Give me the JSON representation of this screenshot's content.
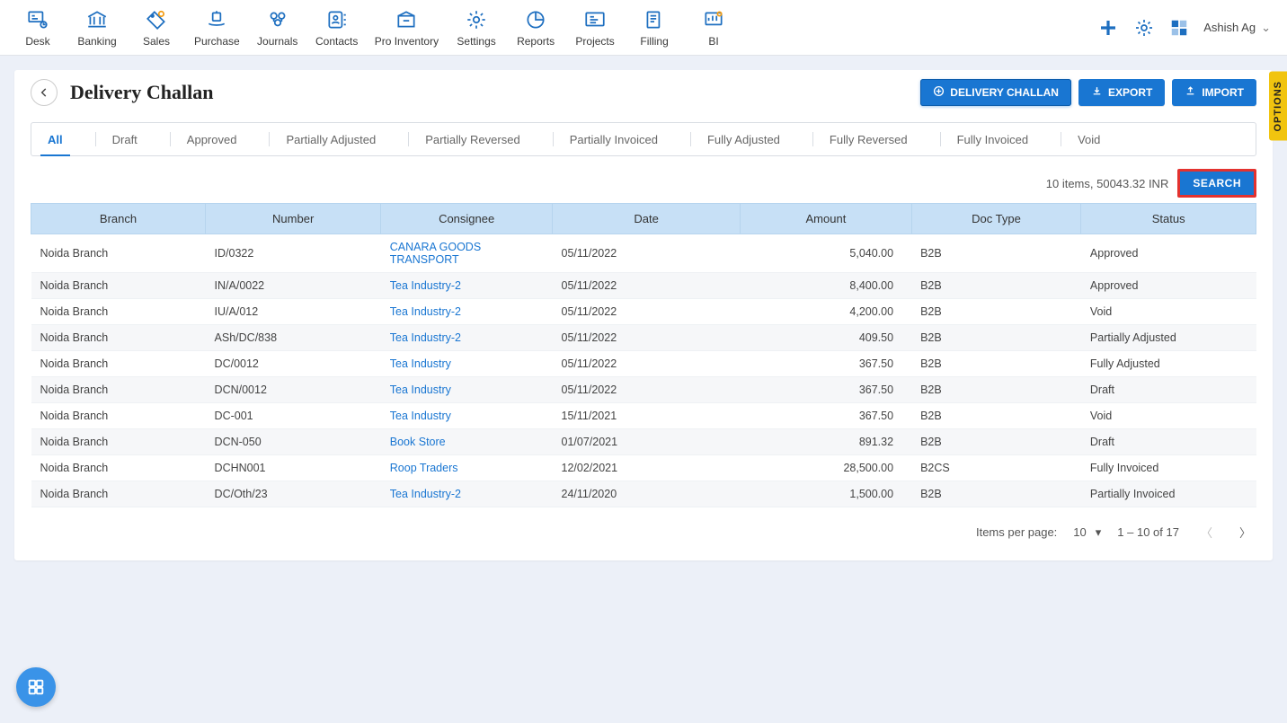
{
  "topnav": {
    "items": [
      {
        "label": "Desk"
      },
      {
        "label": "Banking"
      },
      {
        "label": "Sales"
      },
      {
        "label": "Purchase"
      },
      {
        "label": "Journals"
      },
      {
        "label": "Contacts"
      },
      {
        "label": "Pro Inventory"
      },
      {
        "label": "Settings"
      },
      {
        "label": "Reports"
      },
      {
        "label": "Projects"
      },
      {
        "label": "Filling"
      },
      {
        "label": "BI"
      }
    ],
    "user": "Ashish Ag"
  },
  "page": {
    "title": "Delivery Challan",
    "actions": {
      "create": "DELIVERY CHALLAN",
      "export": "EXPORT",
      "import": "IMPORT"
    }
  },
  "tabs": [
    {
      "label": "All",
      "active": true
    },
    {
      "label": "Draft"
    },
    {
      "label": "Approved"
    },
    {
      "label": "Partially Adjusted"
    },
    {
      "label": "Partially Reversed"
    },
    {
      "label": "Partially Invoiced"
    },
    {
      "label": "Fully Adjusted"
    },
    {
      "label": "Fully Reversed"
    },
    {
      "label": "Fully Invoiced"
    },
    {
      "label": "Void"
    }
  ],
  "summary": "10 items, 50043.32 INR",
  "search_label": "SEARCH",
  "columns": [
    "Branch",
    "Number",
    "Consignee",
    "Date",
    "Amount",
    "Doc Type",
    "Status"
  ],
  "rows": [
    {
      "branch": "Noida Branch",
      "number": "ID/0322",
      "consignee": "CANARA GOODS TRANSPORT",
      "date": "05/11/2022",
      "amount": "5,040.00",
      "doctype": "B2B",
      "status": "Approved"
    },
    {
      "branch": "Noida Branch",
      "number": "IN/A/0022",
      "consignee": "Tea Industry-2",
      "date": "05/11/2022",
      "amount": "8,400.00",
      "doctype": "B2B",
      "status": "Approved"
    },
    {
      "branch": "Noida Branch",
      "number": "IU/A/012",
      "consignee": "Tea Industry-2",
      "date": "05/11/2022",
      "amount": "4,200.00",
      "doctype": "B2B",
      "status": "Void"
    },
    {
      "branch": "Noida Branch",
      "number": "ASh/DC/838",
      "consignee": "Tea Industry-2",
      "date": "05/11/2022",
      "amount": "409.50",
      "doctype": "B2B",
      "status": "Partially Adjusted"
    },
    {
      "branch": "Noida Branch",
      "number": "DC/0012",
      "consignee": "Tea Industry",
      "date": "05/11/2022",
      "amount": "367.50",
      "doctype": "B2B",
      "status": "Fully Adjusted"
    },
    {
      "branch": "Noida Branch",
      "number": "DCN/0012",
      "consignee": "Tea Industry",
      "date": "05/11/2022",
      "amount": "367.50",
      "doctype": "B2B",
      "status": "Draft"
    },
    {
      "branch": "Noida Branch",
      "number": "DC-001",
      "consignee": "Tea Industry",
      "date": "15/11/2021",
      "amount": "367.50",
      "doctype": "B2B",
      "status": "Void"
    },
    {
      "branch": "Noida Branch",
      "number": "DCN-050",
      "consignee": "Book Store",
      "date": "01/07/2021",
      "amount": "891.32",
      "doctype": "B2B",
      "status": "Draft"
    },
    {
      "branch": "Noida Branch",
      "number": "DCHN001",
      "consignee": "Roop Traders",
      "date": "12/02/2021",
      "amount": "28,500.00",
      "doctype": "B2CS",
      "status": "Fully Invoiced"
    },
    {
      "branch": "Noida Branch",
      "number": "DC/Oth/23",
      "consignee": "Tea Industry-2",
      "date": "24/11/2020",
      "amount": "1,500.00",
      "doctype": "B2B",
      "status": "Partially Invoiced"
    }
  ],
  "pager": {
    "label": "Items per page:",
    "size": "10",
    "range": "1 – 10 of 17"
  },
  "options_tab": "OPTIONS"
}
